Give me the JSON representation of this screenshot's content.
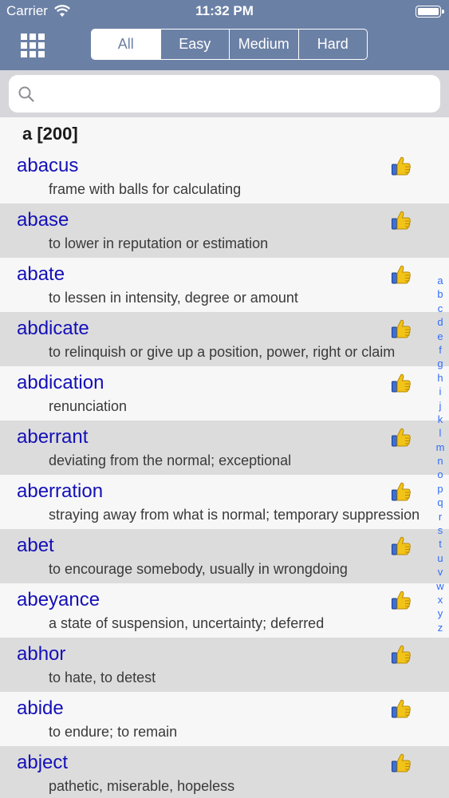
{
  "status_bar": {
    "carrier": "Carrier",
    "time": "11:32 PM"
  },
  "nav": {
    "segments": [
      {
        "label": "All",
        "active": true
      },
      {
        "label": "Easy",
        "active": false
      },
      {
        "label": "Medium",
        "active": false
      },
      {
        "label": "Hard",
        "active": false
      }
    ]
  },
  "search": {
    "placeholder": "",
    "value": ""
  },
  "section": {
    "header": "a [200]"
  },
  "words": [
    {
      "word": "abacus",
      "definition": "frame with balls for calculating"
    },
    {
      "word": "abase",
      "definition": "to lower in reputation or estimation"
    },
    {
      "word": "abate",
      "definition": "to lessen in intensity, degree or amount"
    },
    {
      "word": "abdicate",
      "definition": "to relinquish or give up a position, power, right or claim"
    },
    {
      "word": "abdication",
      "definition": "renunciation"
    },
    {
      "word": "aberrant",
      "definition": "deviating from the normal; exceptional"
    },
    {
      "word": "aberration",
      "definition": "straying away from what is normal; temporary suppression"
    },
    {
      "word": "abet",
      "definition": "to encourage somebody, usually in wrongdoing"
    },
    {
      "word": "abeyance",
      "definition": "a state of suspension, uncertainty; deferred"
    },
    {
      "word": "abhor",
      "definition": "to hate, to detest"
    },
    {
      "word": "abide",
      "definition": "to endure; to remain"
    },
    {
      "word": "abject",
      "definition": "pathetic, miserable, hopeless"
    }
  ],
  "row_icon": "thumbs-up-icon",
  "index_letters": [
    "a",
    "b",
    "c",
    "d",
    "e",
    "f",
    "g",
    "h",
    "i",
    "j",
    "k",
    "l",
    "m",
    "n",
    "o",
    "p",
    "q",
    "r",
    "s",
    "t",
    "u",
    "v",
    "w",
    "x",
    "y",
    "z"
  ],
  "colors": {
    "nav_background": "#6b80a5",
    "word_text": "#1410b8",
    "index_text": "#2f6bff",
    "row_even": "#dcdcdc",
    "row_odd": "#f7f7f7"
  }
}
